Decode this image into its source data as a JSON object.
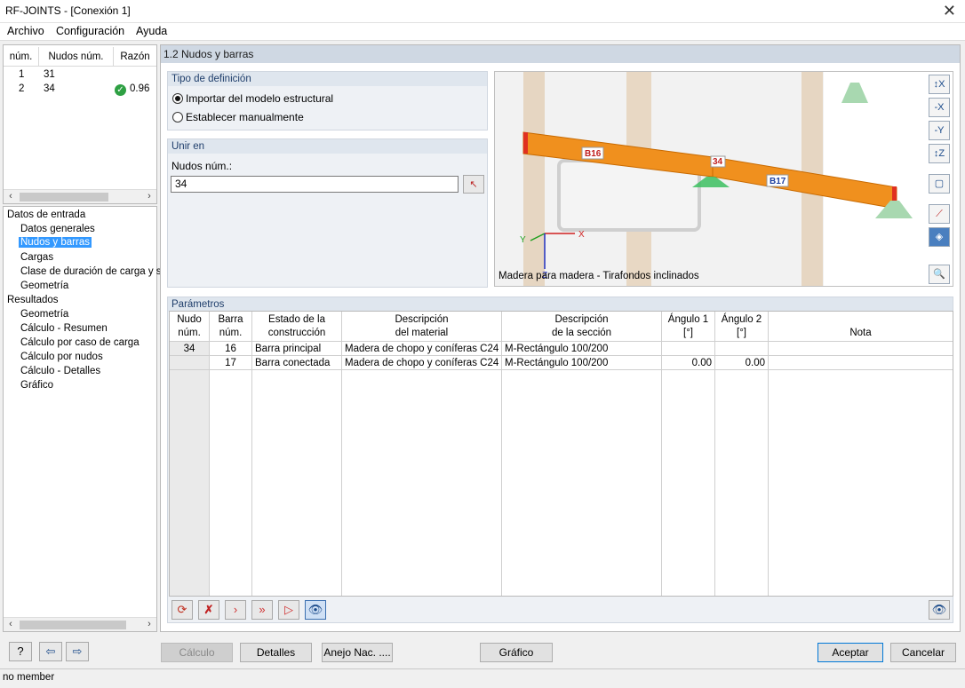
{
  "window": {
    "title": "RF-JOINTS - [Conexión 1]",
    "close": "✕"
  },
  "menu": [
    "Archivo",
    "Configuración",
    "Ayuda"
  ],
  "left_table": {
    "headers": [
      "núm.",
      "Nudos núm.",
      "Razón"
    ],
    "rows": [
      {
        "num": "1",
        "nodes": "31",
        "ratio": ""
      },
      {
        "num": "2",
        "nodes": "34",
        "ratio": "0.96"
      }
    ]
  },
  "tree": {
    "input_root": "Datos de entrada",
    "input_items": [
      "Datos generales",
      "Nudos y barras",
      "Cargas",
      "Clase de duración de carga y se",
      "Geometría"
    ],
    "results_root": "Resultados",
    "results_items": [
      "Geometría",
      "Cálculo - Resumen",
      "Cálculo por caso de carga",
      "Cálculo por nudos",
      "Cálculo - Detalles",
      "Gráfico"
    ]
  },
  "main": {
    "title": "1.2 Nudos y barras",
    "def_type": {
      "title": "Tipo de definición",
      "option1": "Importar del modelo estructural",
      "option2": "Establecer manualmente"
    },
    "join": {
      "title": "Unir en",
      "label": "Nudos núm.:",
      "value": "34"
    },
    "view": {
      "caption": "Madera para madera - Tirafondos inclinados",
      "beam1": "B16",
      "beam2": "B17",
      "node": "34",
      "axis_x": "X",
      "axis_y": "Y",
      "axis_z": "Z",
      "icons": [
        "view-x-icon",
        "view-minus-x-icon",
        "view-minus-y-icon",
        "view-z-icon",
        "view-iso-icon",
        "measure-icon",
        "render-icon",
        "zoom-icon"
      ]
    }
  },
  "params": {
    "title": "Parámetros",
    "headers": [
      [
        "Nudo",
        "núm."
      ],
      [
        "Barra",
        "núm."
      ],
      [
        "Estado de la",
        "construcción"
      ],
      [
        "Descripción",
        "del material"
      ],
      [
        "Descripción",
        "de la sección"
      ],
      [
        "Ángulo 1",
        "[°]"
      ],
      [
        "Ángulo 2",
        "[°]"
      ],
      [
        "",
        "Nota"
      ]
    ],
    "rows": [
      {
        "node": "34",
        "bar": "16",
        "state": "Barra principal",
        "material": "Madera de chopo y coníferas C24",
        "section": "M-Rectángulo 100/200",
        "a1": "",
        "a2": "",
        "note": ""
      },
      {
        "node": "",
        "bar": "17",
        "state": "Barra conectada",
        "material": "Madera de chopo y coníferas C24",
        "section": "M-Rectángulo 100/200",
        "a1": "0.00",
        "a2": "0.00",
        "note": ""
      }
    ]
  },
  "buttons": {
    "calc": "Cálculo",
    "details": "Detalles",
    "annex": "Anejo Nac. ....",
    "graphic": "Gráfico",
    "accept": "Aceptar",
    "cancel": "Cancelar"
  },
  "status": "no member",
  "colors": {
    "accent": "#3399ff",
    "beam": "#f0901e",
    "ok": "#2ea043"
  }
}
